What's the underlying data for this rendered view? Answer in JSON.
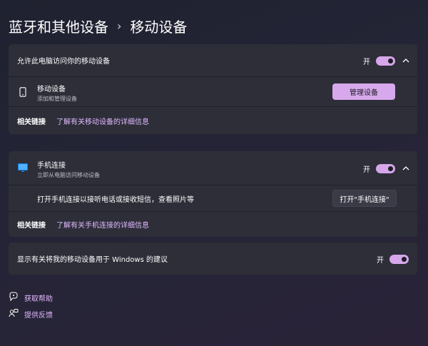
{
  "breadcrumb": {
    "parent": "蓝牙和其他设备",
    "separator": "›",
    "current": "移动设备"
  },
  "card1": {
    "header_label": "允许此电脑访问你的移动设备",
    "toggle_text": "开",
    "device_title": "移动设备",
    "device_sub": "添加和管理设备",
    "manage_button": "管理设备",
    "related_label": "相关链接",
    "related_link": "了解有关移动设备的详细信息"
  },
  "card2": {
    "title": "手机连接",
    "sub": "立即从电脑访问移动设备",
    "toggle_text": "开",
    "desc": "打开手机连接以接听电话或接收短信，查看照片等",
    "open_button": "打开\"手机连接\"",
    "related_label": "相关链接",
    "related_link": "了解有关手机连接的详细信息"
  },
  "card3": {
    "label": "显示有关将我的移动设备用于 Windows 的建议",
    "toggle_text": "开"
  },
  "footer": {
    "help": "获取帮助",
    "feedback": "提供反馈"
  },
  "colors": {
    "accent": "#d8a8ec",
    "link": "#e0b8ff",
    "card": "#2d2e38"
  },
  "icons": [
    "phone-icon",
    "phone-link-icon",
    "chevron-up-icon",
    "help-icon",
    "feedback-icon"
  ]
}
